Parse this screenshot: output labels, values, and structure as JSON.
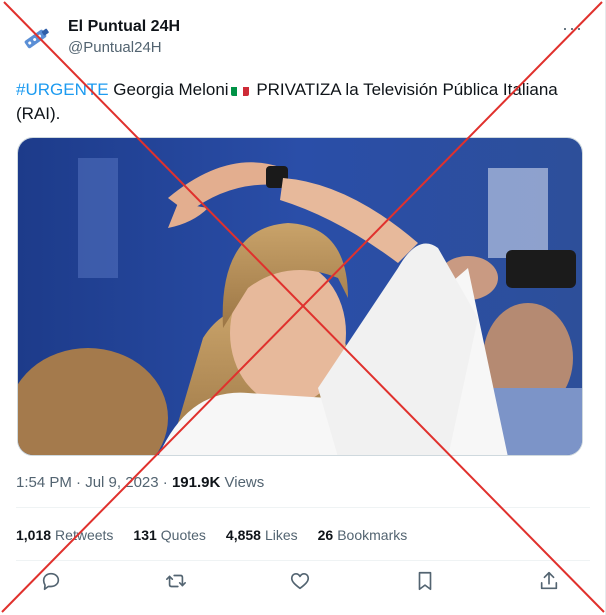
{
  "tweet": {
    "author_name": "El Puntual 24H",
    "author_handle": "@Puntual24H",
    "hashtag": "#URGENTE",
    "text_before_flag": " Georgia Meloni",
    "text_after_flag": " PRIVATIZA la Televisión Pública Italiana (RAI).",
    "time": "1:54 PM",
    "date": "Jul 9, 2023",
    "views_count": "191.9K",
    "views_label": "Views",
    "separator": " · "
  },
  "stats": {
    "retweets_count": "1,018",
    "retweets_label": "Retweets",
    "quotes_count": "131",
    "quotes_label": "Quotes",
    "likes_count": "4,858",
    "likes_label": "Likes",
    "bookmarks_count": "26",
    "bookmarks_label": "Bookmarks"
  },
  "icons": {
    "more": "more-options-icon",
    "reply": "reply-icon",
    "retweet": "retweet-icon",
    "like": "heart-icon",
    "bookmark": "bookmark-icon",
    "share": "share-icon"
  },
  "colors": {
    "hashtag": "#1d9bf0",
    "cross": "#e0312d",
    "muted": "#536471",
    "flag_green": "#009246",
    "flag_white": "#ffffff",
    "flag_red": "#ce2b37"
  }
}
